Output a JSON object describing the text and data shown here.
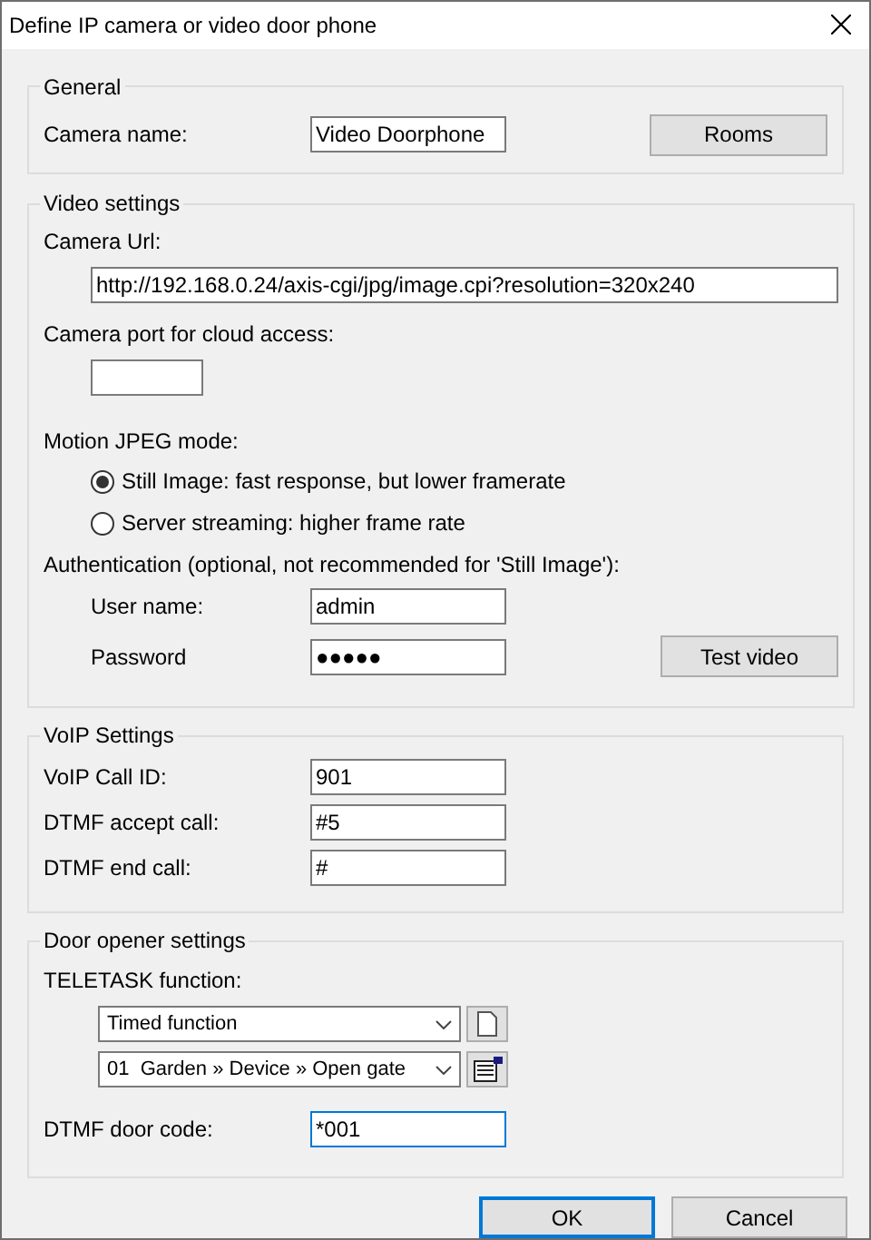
{
  "window": {
    "title": "Define IP camera or video door phone"
  },
  "general": {
    "title": "General",
    "camera_name": {
      "label": "Camera name:",
      "value": "Video Doorphone"
    },
    "rooms_button": "Rooms"
  },
  "video_settings": {
    "title": "Video settings",
    "camera_url": {
      "label": "Camera Url:",
      "value": "http://192.168.0.24/axis-cgi/jpg/image.cpi?resolution=320x240"
    },
    "cloud_port": {
      "label": "Camera port for cloud access:"
    },
    "motion_jpeg": {
      "label": "Motion JPEG mode:",
      "options": [
        {
          "label": "Still Image: fast response, but lower framerate",
          "selected": true
        },
        {
          "label": "Server streaming: higher frame rate",
          "selected": false
        }
      ]
    },
    "authentication": {
      "label": "Authentication (optional, not recommended for 'Still Image'):",
      "user_name": {
        "label": "User name:",
        "value": "admin"
      },
      "password": {
        "label": "Password",
        "value": "●●●●●"
      }
    },
    "test_video_button": "Test video"
  },
  "voip": {
    "title": "VoIP Settings",
    "fields": [
      {
        "label": "VoIP Call ID:",
        "value": "901"
      },
      {
        "label": "DTMF accept call:",
        "value": "#5"
      },
      {
        "label": "DTMF end call:",
        "value": "#"
      }
    ]
  },
  "door_opener": {
    "title": "Door opener settings",
    "function_label": "TELETASK function:",
    "selects": [
      {
        "value": "Timed function",
        "kind": "new"
      },
      {
        "value": "01  Garden » Device » Open gate",
        "kind": "properties"
      }
    ],
    "door_code": {
      "label": "DTMF door code:",
      "value": "*001",
      "focused": true
    }
  },
  "buttons": [
    {
      "label": "OK",
      "default": true
    },
    {
      "label": "Cancel",
      "default": false
    }
  ]
}
